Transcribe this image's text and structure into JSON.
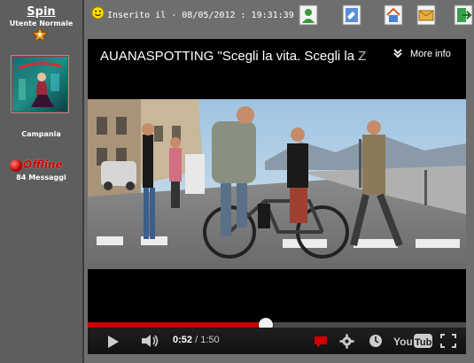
{
  "user": {
    "name": "Spin",
    "rank": "Utente Normale",
    "region": "Campania",
    "status": "Offline",
    "messages": "84 Messaggi"
  },
  "post": {
    "timestamp": "Inserito il - 08/05/2012 : 19:31:39"
  },
  "toolbar": {
    "buttons": [
      "profile-icon",
      "edit-icon",
      "home-icon",
      "email-icon",
      "exit-icon"
    ]
  },
  "video": {
    "title": "AUANASPOTTING \"Scegli la vita. Scegli la Z",
    "more_info": "More info",
    "current_time": "0:52",
    "separator": "/",
    "duration": "1:50",
    "progress": 0.47,
    "brand": "YouTube"
  },
  "colors": {
    "sidebar_bg": "#5e5e5e",
    "page_bg": "#6e6e6e",
    "progress_red": "#cc0000",
    "offline_red": "#cc0000"
  }
}
